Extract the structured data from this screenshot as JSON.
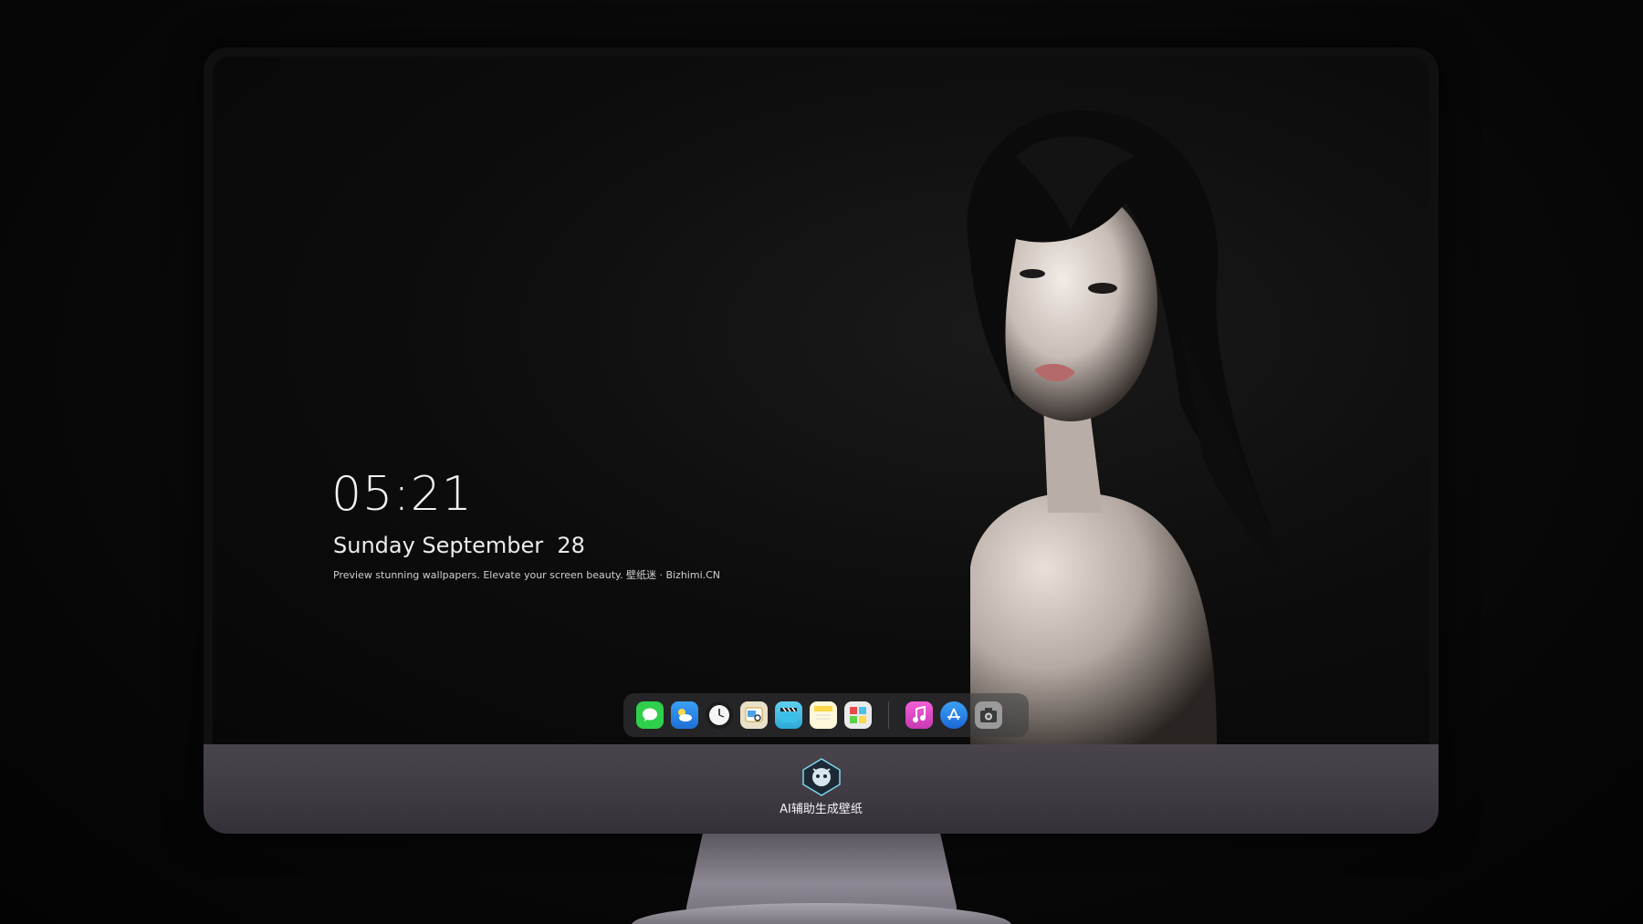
{
  "lockscreen": {
    "time": "05:21",
    "date": "Sunday September  28",
    "tagline": "Preview stunning wallpapers. Elevate your screen beauty. 壁纸迷 · Bizhimi.CN"
  },
  "dock": {
    "apps": [
      {
        "name": "messages-icon",
        "color": "#2fcf4b"
      },
      {
        "name": "weather-icon",
        "color": "#2f8ef0"
      },
      {
        "name": "clock-icon",
        "color": "#f5f5f5"
      },
      {
        "name": "preview-icon",
        "color": "#e9c84a"
      },
      {
        "name": "clips-icon",
        "color": "#4fc3e8"
      },
      {
        "name": "notes-icon",
        "color": "#ffd84a"
      },
      {
        "name": "photo-booth-icon",
        "color": "#e8e8e8"
      },
      {
        "name": "music-icon",
        "color": "#e94fc9"
      },
      {
        "name": "app-store-icon",
        "color": "#2f8ef0"
      },
      {
        "name": "camera-icon",
        "color": "#8c8c8c"
      }
    ]
  },
  "monitor": {
    "brand_text": "AI辅助生成壁纸"
  }
}
